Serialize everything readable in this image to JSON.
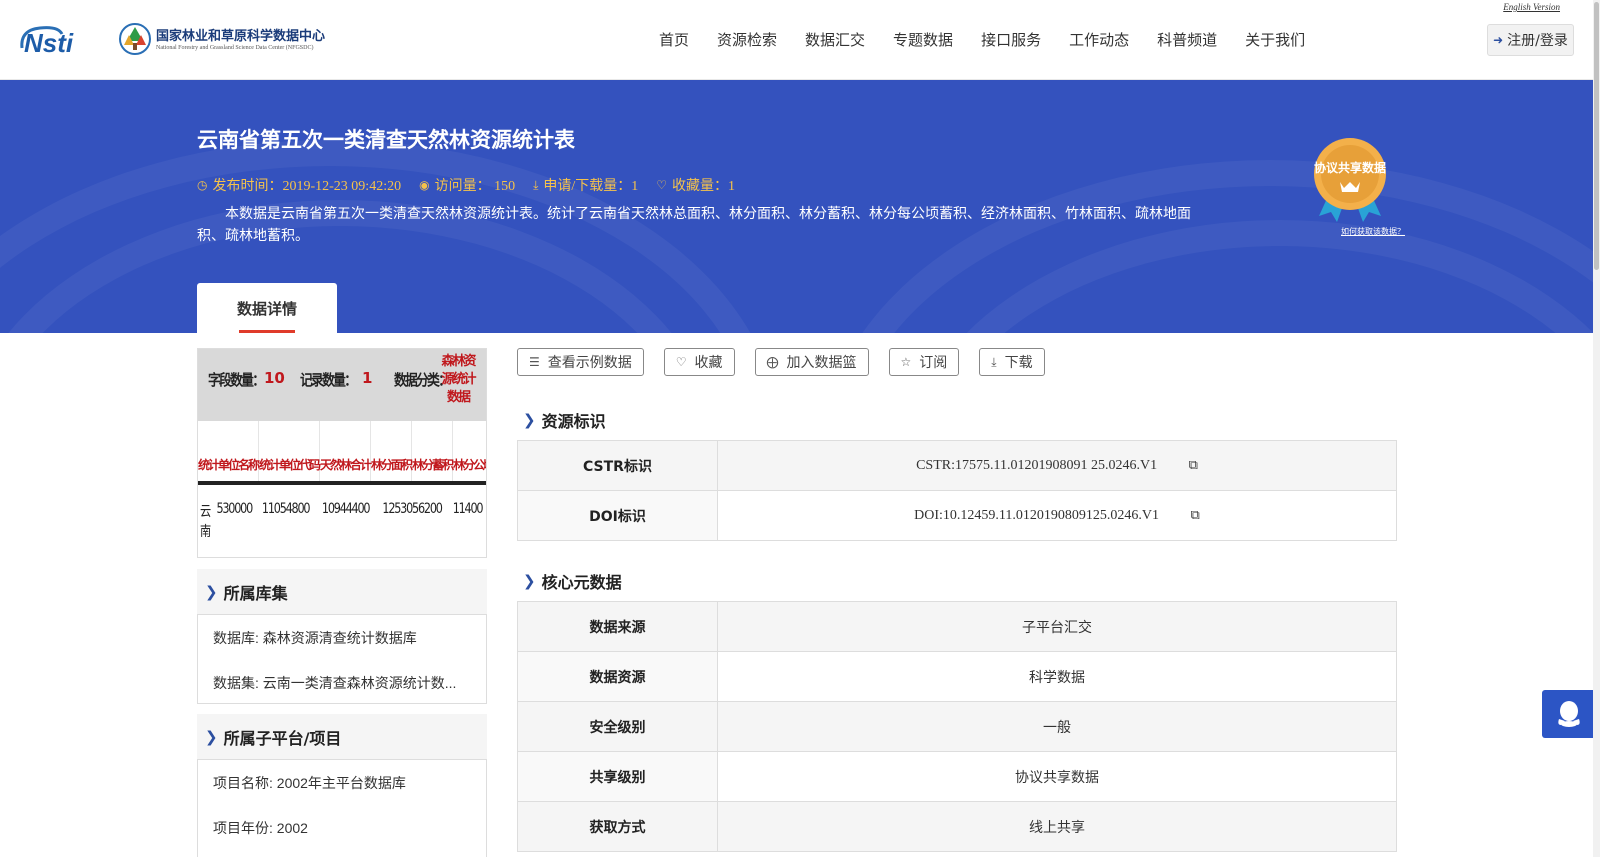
{
  "header": {
    "org_name_cn": "国家林业和草原科学数据中心",
    "org_name_en": "National Forestry and Grassland Science Data Center (NFGSDC)",
    "english_link": "English Version",
    "login_label": "注册/登录",
    "nav": [
      "首页",
      "资源检索",
      "数据汇交",
      "专题数据",
      "接口服务",
      "工作动态",
      "科普频道",
      "关于我们"
    ]
  },
  "dataset": {
    "title": "云南省第五次一类清查天然林资源统计表",
    "publish_time": "发布时间：2019-12-23 09:42:20",
    "visits": "访问量： 150",
    "downloads": "申请/下载量：1",
    "favorites": "收藏量：1",
    "description": "本数据是云南省第五次一类清查天然林资源统计表。统计了云南省天然林总面积、林分面积、林分蓄积、林分每公顷蓄积、经济林面积、竹林面积、疏林地面积、疏林地蓄积。",
    "badge_label": "协议共享数据",
    "badge_link": "如何获取该数据？",
    "tab_label": "数据详情"
  },
  "preview": {
    "field_count_label": "字段数量：",
    "field_count": "10",
    "record_count_label": "记录数量：",
    "record_count": "1",
    "category_label": "数据分类：",
    "category": "森林资源统计数据",
    "columns": [
      "统计单位名称",
      "统计单位代码",
      "天然林合计",
      "林分面积",
      "林分蓄积",
      "林分公顷蓄积"
    ],
    "row": [
      "云南",
      "530000",
      "11054800",
      "10944400",
      "1253056200",
      "11400"
    ]
  },
  "sidebar": {
    "library_title": "所属库集",
    "database": "数据库: 森林资源清查统计数据库",
    "dataset": "数据集: 云南一类清查森林资源统计数...",
    "platform_title": "所属子平台/项目",
    "project_name": "项目名称: 2002年主平台数据库",
    "project_year": "项目年份: 2002"
  },
  "actions": {
    "sample": "查看示例数据",
    "favorite": "收藏",
    "basket": "加入数据篮",
    "subscribe": "订阅",
    "download": "下载"
  },
  "identity": {
    "title": "资源标识",
    "rows": [
      {
        "key": "CSTR标识",
        "value": "CSTR:17575.11.01201908091 25.0246.V1"
      },
      {
        "key": "DOI标识",
        "value": "DOI:10.12459.11.0120190809125.0246.V1"
      }
    ]
  },
  "core": {
    "title": "核心元数据",
    "rows": [
      {
        "key": "数据来源",
        "value": "子平台汇交"
      },
      {
        "key": "数据资源",
        "value": "科学数据"
      },
      {
        "key": "安全级别",
        "value": "一般"
      },
      {
        "key": "共享级别",
        "value": "协议共享数据"
      },
      {
        "key": "获取方式",
        "value": "线上共享"
      }
    ]
  }
}
